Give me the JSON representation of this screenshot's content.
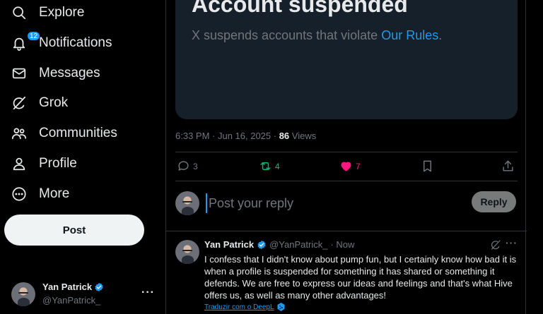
{
  "sidebar": {
    "items": [
      {
        "label": "Explore",
        "icon": "search-icon"
      },
      {
        "label": "Notifications",
        "icon": "bell-icon",
        "badge": "12"
      },
      {
        "label": "Messages",
        "icon": "envelope-icon"
      },
      {
        "label": "Grok",
        "icon": "grok-icon"
      },
      {
        "label": "Communities",
        "icon": "communities-icon"
      },
      {
        "label": "Profile",
        "icon": "person-icon"
      },
      {
        "label": "More",
        "icon": "more-circle-icon"
      }
    ],
    "post_label": "Post",
    "account": {
      "name": "Yan Patrick",
      "handle": "@YanPatrick_",
      "more": "···"
    }
  },
  "suspended": {
    "title": "Account suspended",
    "desc": "X suspends accounts that violate",
    "link": "Our Rules",
    "period": "."
  },
  "post_meta": {
    "timestamp": "6:33 PM · Jun 16, 2025 · ",
    "views_count": "86",
    "views_label": " Views"
  },
  "actions": {
    "replies": "3",
    "reposts": "4",
    "likes": "7"
  },
  "reply_box": {
    "placeholder": "Post your reply",
    "button_label": "Reply"
  },
  "reply_post": {
    "name": "Yan Patrick",
    "handle": "@YanPatrick_",
    "time": "· Now",
    "text": "I confess that I didn't know about pump fun, but I certainly know how bad it is when a profile is suspended for something it has shared or something it defends. We are free to express our ideas and feelings and that's what Hive offers us, as well as many other advantages!",
    "translate": "Traduzir com o DeepL",
    "more": "···"
  },
  "colors": {
    "accent": "#1d9bf0",
    "repost_green": "#00ba7c",
    "like_pink": "#f91880"
  }
}
